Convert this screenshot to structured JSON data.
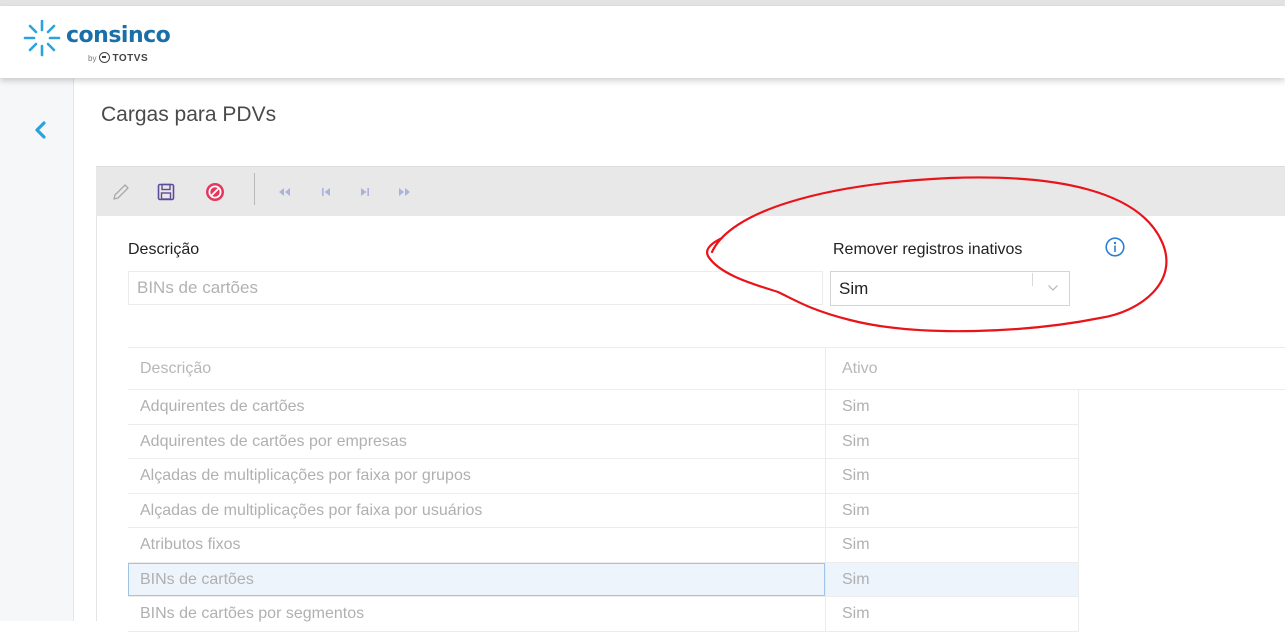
{
  "header": {
    "brand": "consinco",
    "sub_by": "by",
    "sub_company": "TOTVS"
  },
  "colors": {
    "brand_blue": "#1a6fa8",
    "logo_cyan": "#2aa3dc",
    "cancel_red": "#e5375b",
    "annotation_red": "#e8141a"
  },
  "sidebar": {
    "back_icon": "chevron-left-icon"
  },
  "page": {
    "title": "Cargas para PDVs"
  },
  "toolbar": {
    "icons": [
      "pencil-icon",
      "save-icon",
      "cancel-icon",
      "first-icon",
      "previous-icon",
      "next-icon",
      "last-icon"
    ]
  },
  "form": {
    "descricao_label": "Descrição",
    "descricao_value": "BINs de cartões",
    "remover_label": "Remover registros inativos",
    "remover_value": "Sim"
  },
  "grid": {
    "columns": [
      "Descrição",
      "Ativo"
    ],
    "rows": [
      {
        "descricao": "Adquirentes de cartões",
        "ativo": "Sim"
      },
      {
        "descricao": "Adquirentes de cartões por empresas",
        "ativo": "Sim"
      },
      {
        "descricao": "Alçadas de multiplicações por faixa por grupos",
        "ativo": "Sim"
      },
      {
        "descricao": "Alçadas de multiplicações por faixa por usuários",
        "ativo": "Sim"
      },
      {
        "descricao": "Atributos fixos",
        "ativo": "Sim"
      },
      {
        "descricao": "BINs de cartões",
        "ativo": "Sim"
      },
      {
        "descricao": "BINs de cartões por segmentos",
        "ativo": "Sim"
      }
    ],
    "selected_row": "BINs de cartões"
  }
}
